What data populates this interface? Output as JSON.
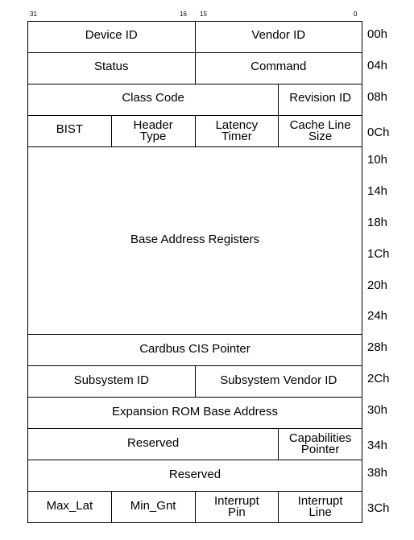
{
  "bit_labels": [
    "31",
    "16",
    "15",
    "0"
  ],
  "rows": [
    {
      "offset": "00h",
      "cells": [
        {
          "label": "Device ID",
          "bytes": 2
        },
        {
          "label": "Vendor ID",
          "bytes": 2
        }
      ]
    },
    {
      "offset": "04h",
      "cells": [
        {
          "label": "Status",
          "bytes": 2
        },
        {
          "label": "Command",
          "bytes": 2
        }
      ]
    },
    {
      "offset": "08h",
      "cells": [
        {
          "label": "Class Code",
          "bytes": 3
        },
        {
          "label": "Revision ID",
          "bytes": 1
        }
      ]
    },
    {
      "offset": "0Ch",
      "cells": [
        {
          "label": "BIST",
          "bytes": 1
        },
        {
          "label": "Header\nType",
          "bytes": 1
        },
        {
          "label": "Latency\nTimer",
          "bytes": 1
        },
        {
          "label": "Cache Line\nSize",
          "bytes": 1
        }
      ]
    },
    {
      "offset": "10h",
      "cells": [
        {
          "label": "Base Address Registers",
          "bytes": 4,
          "rows": 6
        }
      ]
    },
    {
      "offset": "14h",
      "cells": []
    },
    {
      "offset": "18h",
      "cells": []
    },
    {
      "offset": "1Ch",
      "cells": []
    },
    {
      "offset": "20h",
      "cells": []
    },
    {
      "offset": "24h",
      "cells": []
    },
    {
      "offset": "28h",
      "cells": [
        {
          "label": "Cardbus CIS Pointer",
          "bytes": 4
        }
      ]
    },
    {
      "offset": "2Ch",
      "cells": [
        {
          "label": "Subsystem ID",
          "bytes": 2
        },
        {
          "label": "Subsystem Vendor ID",
          "bytes": 2
        }
      ]
    },
    {
      "offset": "30h",
      "cells": [
        {
          "label": "Expansion ROM Base Address",
          "bytes": 4
        }
      ]
    },
    {
      "offset": "34h",
      "cells": [
        {
          "label": "Reserved",
          "bytes": 3
        },
        {
          "label": "Capabilities\nPointer",
          "bytes": 1
        }
      ]
    },
    {
      "offset": "38h",
      "cells": [
        {
          "label": "Reserved",
          "bytes": 4
        }
      ]
    },
    {
      "offset": "3Ch",
      "cells": [
        {
          "label": "Max_Lat",
          "bytes": 1
        },
        {
          "label": "Min_Gnt",
          "bytes": 1
        },
        {
          "label": "Interrupt\nPin",
          "bytes": 1
        },
        {
          "label": "Interrupt\nLine",
          "bytes": 1
        }
      ]
    }
  ]
}
